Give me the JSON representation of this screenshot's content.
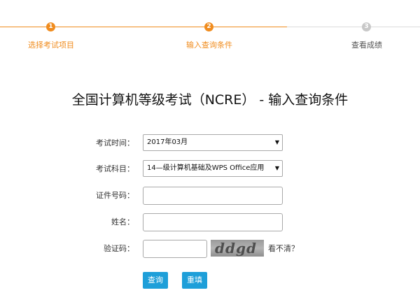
{
  "steps": [
    {
      "number": "1",
      "label": "选择考试项目",
      "state": "done"
    },
    {
      "number": "2",
      "label": "输入查询条件",
      "state": "current"
    },
    {
      "number": "3",
      "label": "查看成绩",
      "state": "pending"
    }
  ],
  "title": "全国计算机等级考试（NCRE） - 输入查询条件",
  "form": {
    "exam_time": {
      "label": "考试时间：",
      "value": "2017年03月"
    },
    "subject": {
      "label": "考试科目：",
      "value": "14—级计算机基础及WPS Office应用"
    },
    "id_number": {
      "label": "证件号码：",
      "value": ""
    },
    "name": {
      "label": "姓名：",
      "value": ""
    },
    "captcha": {
      "label": "验证码：",
      "value": "",
      "image_text": "ddgd",
      "refresh_text": "看不清？"
    }
  },
  "buttons": {
    "query": "查询",
    "reset": "重填"
  },
  "colors": {
    "accent": "#f08c1e",
    "button": "#1e9fd9",
    "pending": "#c8c8c8"
  }
}
